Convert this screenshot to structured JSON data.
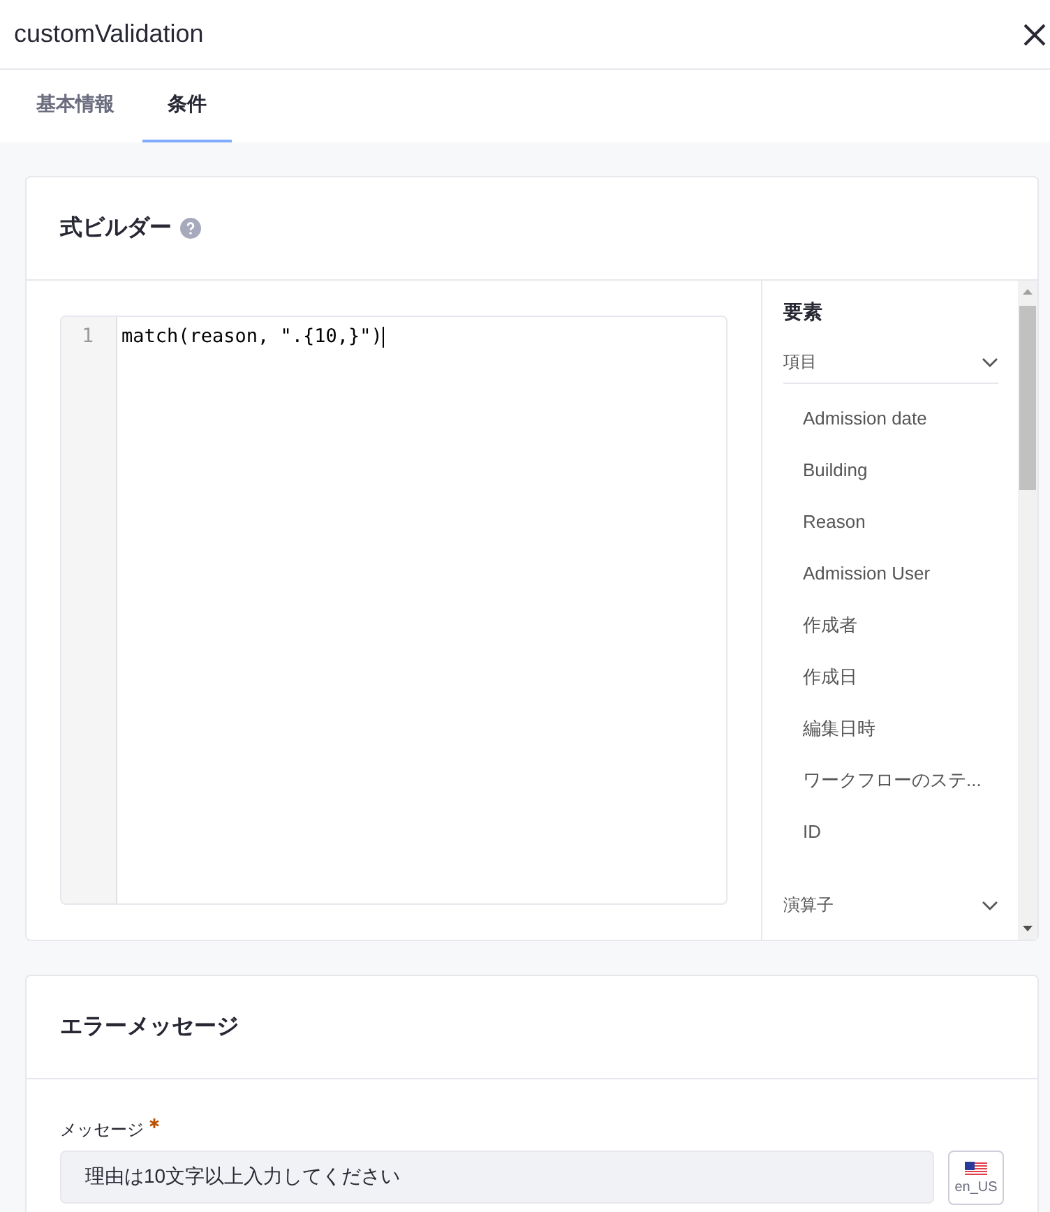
{
  "window": {
    "title": "customValidation"
  },
  "tabs": [
    {
      "label": "基本情報",
      "selected": false
    },
    {
      "label": "条件",
      "selected": true
    }
  ],
  "expression_builder": {
    "title": "式ビルダー",
    "editor": {
      "line_numbers": [
        "1"
      ],
      "code": "match(reason, \".{10,}\")"
    },
    "elements_panel": {
      "title": "要素",
      "sections": [
        {
          "label": "項目",
          "items": [
            "Admission date",
            "Building",
            "Reason",
            "Admission User",
            "作成者",
            "作成日",
            "編集日時",
            "ワークフローのステ...",
            "ID"
          ]
        },
        {
          "label": "演算子"
        }
      ]
    }
  },
  "error_message": {
    "title": "エラーメッセージ",
    "field": {
      "label": "メッセージ",
      "required": true,
      "value": "理由は10文字以上入力してください",
      "locale": "en_US"
    }
  }
}
